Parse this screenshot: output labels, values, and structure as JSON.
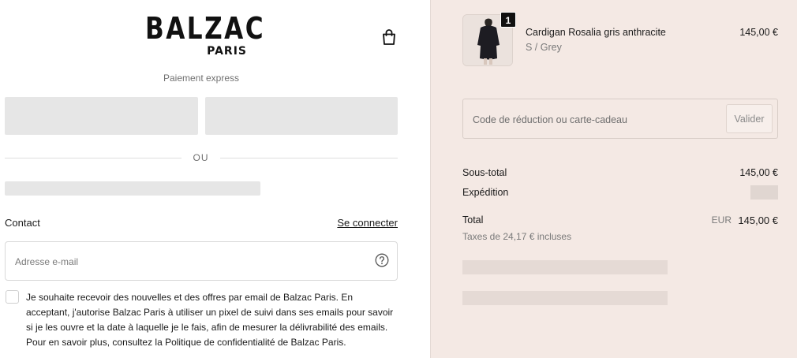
{
  "brand": {
    "name": "BALZAC",
    "sub": "PARIS"
  },
  "icons": {
    "cart": "shopping-bag-icon",
    "help": "question-circle-icon"
  },
  "express": {
    "title": "Paiement express",
    "separator": "OU"
  },
  "contact": {
    "heading": "Contact",
    "login_link": "Se connecter",
    "email_placeholder": "Adresse e-mail",
    "email_value": "",
    "newsletter_checked": false,
    "newsletter_text": "Je souhaite recevoir des nouvelles et des offres par email de Balzac Paris. En acceptant, j'autorise Balzac Paris à utiliser un pixel de suivi dans ses emails pour savoir si je les ouvre et la date à laquelle je le fais, afin de mesurer la délivrabilité des emails. Pour en savoir plus, consultez la Politique de confidentialité de Balzac Paris."
  },
  "order": {
    "item": {
      "quantity": "1",
      "name": "Cardigan Rosalia gris anthracite",
      "variant": "S / Grey",
      "price": "145,00 €"
    },
    "discount": {
      "placeholder": "Code de réduction ou carte-cadeau",
      "value": "",
      "apply_label": "Valider"
    },
    "subtotal_label": "Sous-total",
    "subtotal_value": "145,00 €",
    "shipping_label": "Expédition",
    "total_label": "Total",
    "currency": "EUR",
    "total_value": "145,00 €",
    "taxes_note": "Taxes de 24,17 € incluses"
  },
  "colors": {
    "summary_bg": "#f4e9e4",
    "skeleton": "#e6e6e6",
    "text": "#1a1a1a",
    "muted": "#707070"
  }
}
